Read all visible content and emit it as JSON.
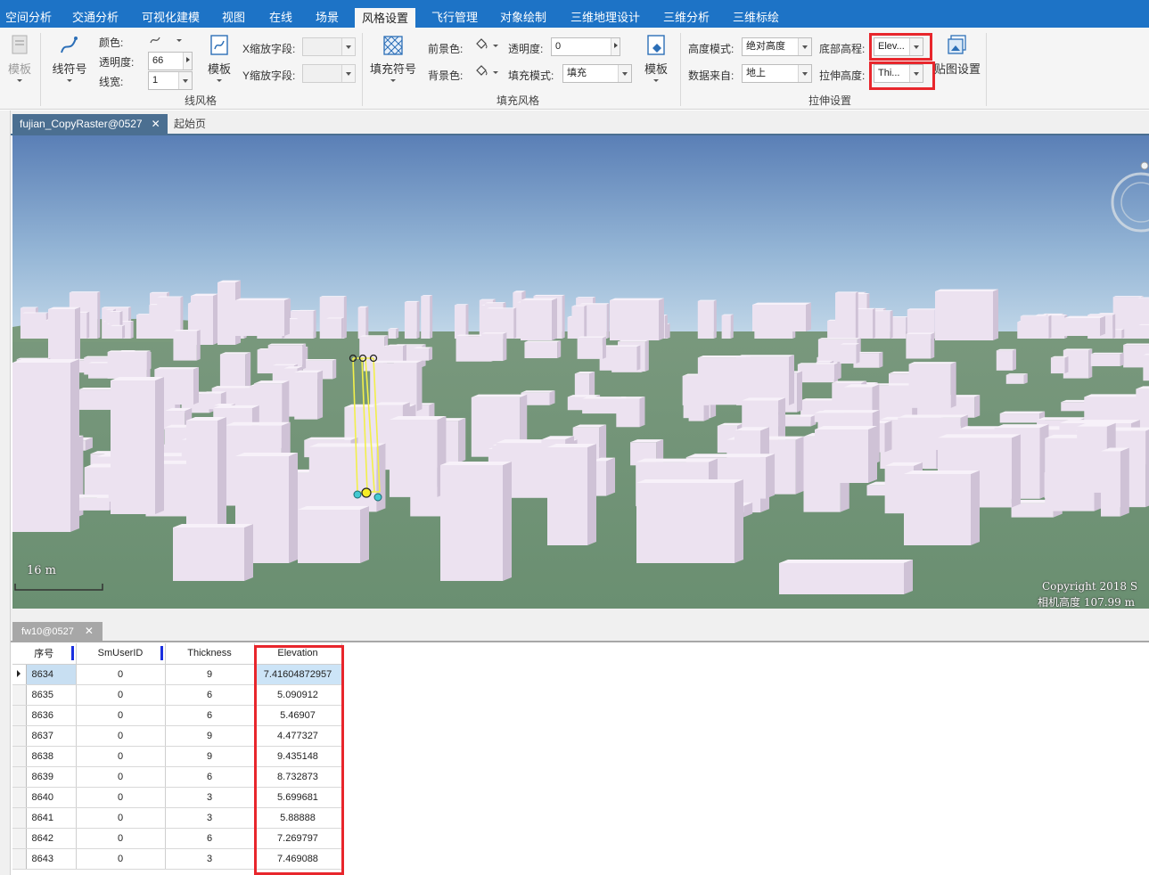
{
  "menu": {
    "tabs": [
      "空间分析",
      "交通分析",
      "可视化建模",
      "视图",
      "在线",
      "场景",
      "风格设置",
      "飞行管理",
      "对象绘制",
      "三维地理设计",
      "三维分析",
      "三维标绘"
    ],
    "active_tab": "风格设置"
  },
  "ribbon": {
    "template_left": "模板",
    "line_style": {
      "symbol_button": "线符号",
      "color_label": "颜色:",
      "opacity_label": "透明度:",
      "opacity_value": "66",
      "width_label": "线宽:",
      "width_value": "1",
      "template_button": "模板",
      "x_scale_label": "X缩放字段:",
      "y_scale_label": "Y缩放字段:",
      "group_title": "线风格"
    },
    "fill_style": {
      "symbol_button": "填充符号",
      "fg_label": "前景色:",
      "bg_label": "背景色:",
      "opacity_label": "透明度:",
      "opacity_value": "0",
      "fill_mode_label": "填充模式:",
      "fill_mode_value": "填充",
      "template_button": "模板",
      "group_title": "填充风格"
    },
    "extrude": {
      "height_mode_label": "高度模式:",
      "height_mode_value": "绝对高度",
      "data_source_label": "数据来自:",
      "data_source_value": "地上",
      "base_elev_label": "底部高程:",
      "base_elev_value": "Elev...",
      "extrude_height_label": "拉伸高度:",
      "extrude_height_value": "Thi...",
      "side_settings_button": "贴图设置",
      "group_title": "拉伸设置"
    }
  },
  "doc_tabs": {
    "active": "fujian_CopyRaster@0527",
    "close": "✕",
    "second": "起始页"
  },
  "scene": {
    "scale_text": "16 m",
    "copyright": "Copyright 2018 S",
    "camera_height": "相机高度 107.99 m",
    "colors": {
      "sky_top": "#5a7fb6",
      "sky_bottom": "#b9d4e6",
      "ground": "#6f9374",
      "building": "#ece2f0"
    }
  },
  "attribute_table": {
    "tab_label": "fw10@0527",
    "close": "✕",
    "columns": [
      "序号",
      "SmUserID",
      "Thickness",
      "Elevation"
    ],
    "rows": [
      [
        "8634",
        "0",
        "9",
        "7.41604872957"
      ],
      [
        "8635",
        "0",
        "6",
        "5.090912"
      ],
      [
        "8636",
        "0",
        "6",
        "5.46907"
      ],
      [
        "8637",
        "0",
        "9",
        "4.477327"
      ],
      [
        "8638",
        "0",
        "9",
        "9.435148"
      ],
      [
        "8639",
        "0",
        "6",
        "8.732873"
      ],
      [
        "8640",
        "0",
        "3",
        "5.699681"
      ],
      [
        "8641",
        "0",
        "3",
        "5.88888"
      ],
      [
        "8642",
        "0",
        "6",
        "7.269797"
      ],
      [
        "8643",
        "0",
        "3",
        "7.469088"
      ]
    ],
    "selected_row": "8634"
  }
}
